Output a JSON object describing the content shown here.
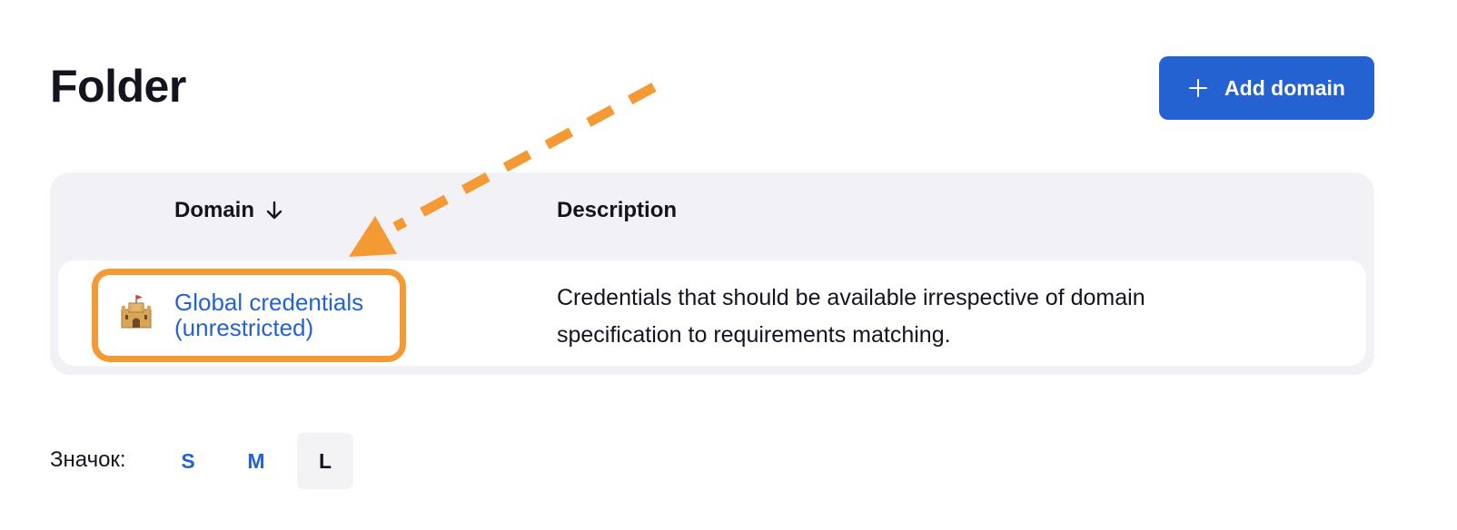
{
  "header": {
    "title": "Folder",
    "add_button_label": "Add domain"
  },
  "table": {
    "columns": [
      "Domain",
      "Description"
    ],
    "rows": [
      {
        "icon": "castle-icon",
        "domain_lines": [
          "Global credentials",
          "(unrestricted)"
        ],
        "description_lines": [
          "Credentials that should be available irrespective of domain",
          "specification to requirements matching."
        ]
      }
    ]
  },
  "icon_size": {
    "label": "Значок:",
    "options": [
      "S",
      "M",
      "L"
    ],
    "selected": "L"
  },
  "colors": {
    "accent": "#2462d2",
    "annotation": "#f39a35",
    "card_bg": "#f2f2f6"
  }
}
